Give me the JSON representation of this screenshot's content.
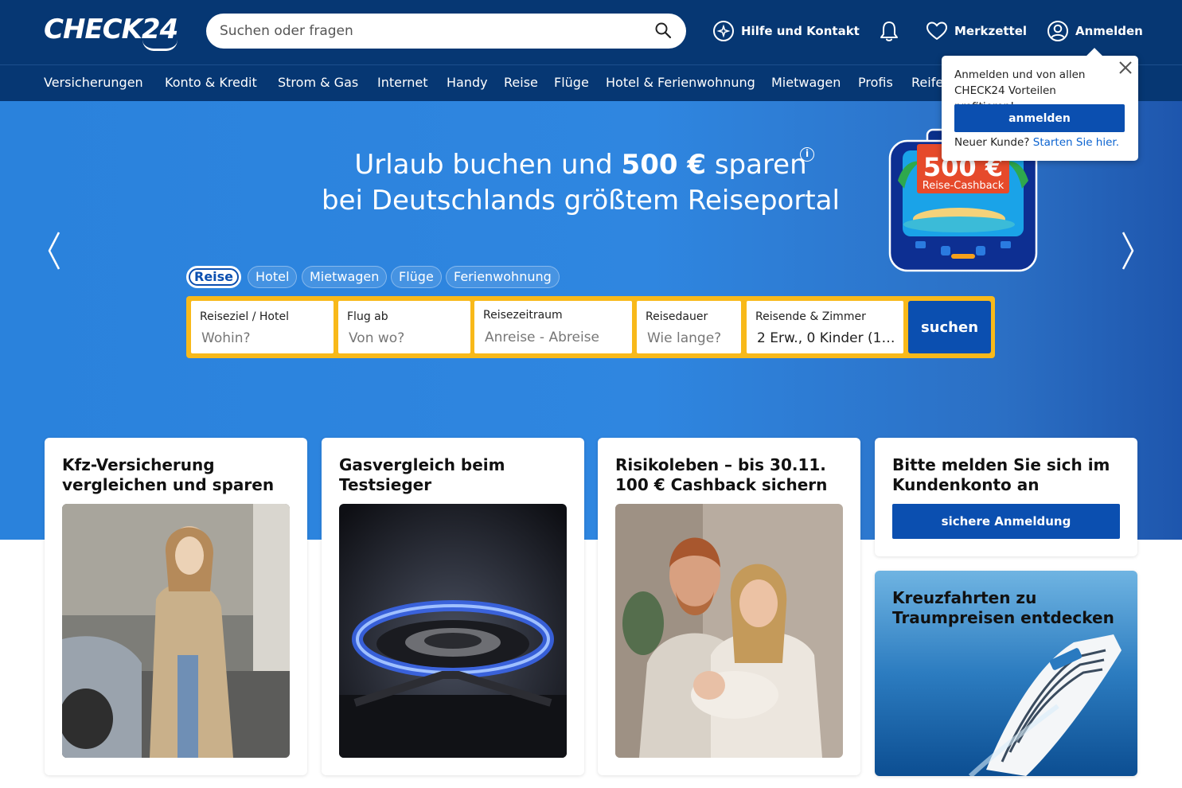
{
  "header": {
    "logo_text": "CHECK24",
    "search_placeholder": "Suchen oder fragen",
    "help_label": "Hilfe und Kontakt",
    "wishlist_label": "Merkzettel",
    "login_label": "Anmelden"
  },
  "nav": {
    "items": [
      "Versicherungen",
      "Konto & Kredit",
      "Strom & Gas",
      "Internet",
      "Handy",
      "Reise",
      "Flüge",
      "Hotel & Ferienwohnung",
      "Mietwagen",
      "Profis",
      "Reife"
    ]
  },
  "hero": {
    "title_line1_pre": "Urlaub buchen und ",
    "title_line1_bold": "500 €",
    "title_line1_post": " sparen",
    "title_line2": "bei Deutschlands größtem Reiseportal",
    "info_symbol": "i",
    "badge_amount": "500 €",
    "badge_label": "Reise-Cashback"
  },
  "tabs": [
    "Reise",
    "Hotel",
    "Mietwagen",
    "Flüge",
    "Ferienwohnung"
  ],
  "search_form": {
    "destination_label": "Reiseziel / Hotel",
    "destination_placeholder": "Wohin?",
    "departure_label": "Flug ab",
    "departure_placeholder": "Von wo?",
    "period_label": "Reisezeitraum",
    "period_placeholder": "Anreise - Abreise",
    "duration_label": "Reisedauer",
    "duration_placeholder": "Wie lange?",
    "travellers_label": "Reisende & Zimmer",
    "travellers_value": "2 Erw., 0 Kinder (1…",
    "submit_label": "suchen"
  },
  "login_popup": {
    "text": "Anmelden und von allen CHECK24 Vorteilen profitieren!",
    "button_label": "anmelden",
    "new_customer_text": "Neuer Kunde?",
    "new_customer_link": "Starten Sie hier."
  },
  "cards": {
    "kfz_title": "Kfz-Versicherung vergleichen und sparen",
    "gas_title": "Gasvergleich beim Testsieger",
    "risiko_title": "Risikoleben – bis 30.11. 100 € Cashback sichern",
    "account_title": "Bitte melden Sie sich im Kundenkonto an",
    "account_button": "sichere Anmeldung",
    "cruise_title": "Kreuzfahrten zu Traumpreisen entdecken"
  },
  "colors": {
    "header_bg": "#063773",
    "primary_blue": "#0b4fb0",
    "form_border": "#f8b91a",
    "hero_blue": "#2f86e0"
  }
}
